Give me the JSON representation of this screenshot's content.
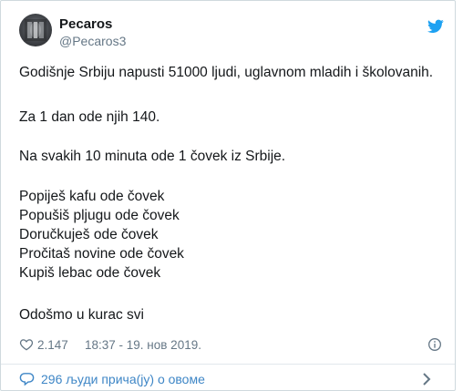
{
  "user": {
    "name": "Pecaros",
    "handle": "@Pecaros3"
  },
  "tweet": {
    "lines": [
      "Godišnje Srbiju napusti 51000 ljudi, uglavnom mladih i školovanih.",
      "Za 1 dan ode njih 140.",
      "Na svakih 10 minuta ode 1 čovek iz Srbije.",
      "Popiješ kafu ode čovek",
      "Popušiš pljugu ode čovek",
      "Doručkuješ ode čovek",
      "Pročitaš novine ode čovek",
      "Kupiš lebac ode čovek",
      "Odošmo u kurac svi"
    ]
  },
  "meta": {
    "likes": "2.147",
    "timestamp": "18:37 - 19. нов 2019."
  },
  "footer": {
    "people_talking": "296 људи прича(ју) о овоме"
  },
  "colors": {
    "twitter_blue": "#1da1f2",
    "link_blue": "#3e86c6",
    "muted": "#657786",
    "border": "#cfd9de"
  },
  "icons": {
    "brand": "twitter-bird-icon",
    "like": "heart-icon",
    "info": "info-icon",
    "comment": "comment-icon",
    "more": "chevron-right-icon"
  }
}
